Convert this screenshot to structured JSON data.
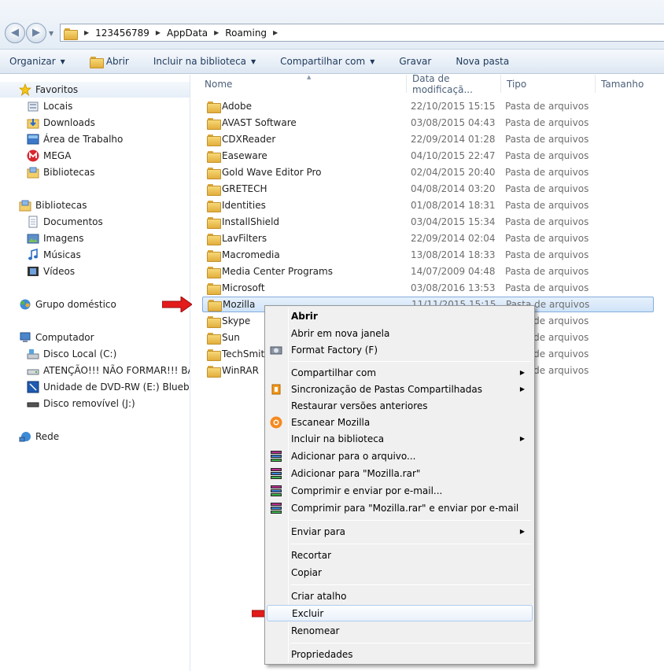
{
  "address": {
    "crumbs": [
      "123456789",
      "AppData",
      "Roaming"
    ]
  },
  "toolbar": {
    "organize": "Organizar",
    "open": "Abrir",
    "include_library": "Incluir na biblioteca",
    "share_with": "Compartilhar com",
    "burn": "Gravar",
    "new_folder": "Nova pasta"
  },
  "nav": {
    "favorites": "Favoritos",
    "places": "Locais",
    "downloads": "Downloads",
    "desktop": "Área de Trabalho",
    "mega": "MEGA",
    "libraries_fav": "Bibliotecas",
    "libraries": "Bibliotecas",
    "documents": "Documentos",
    "images": "Imagens",
    "music": "Músicas",
    "videos": "Vídeos",
    "homegroup": "Grupo doméstico",
    "computer": "Computador",
    "local_disk": "Disco Local (C:)",
    "warning_disk": "ATENÇÃO!!! NÃO FORMAR!!!  BACK",
    "dvd": "Unidade de DVD-RW (E:) Bluebirds",
    "removable": "Disco removível (J:)",
    "network": "Rede"
  },
  "columns": {
    "name": "Nome",
    "date": "Data de modificaçã...",
    "type": "Tipo",
    "size": "Tamanho"
  },
  "files": [
    {
      "name": "Adobe",
      "date": "22/10/2015 15:15",
      "type": "Pasta de arquivos"
    },
    {
      "name": "AVAST Software",
      "date": "03/08/2015 04:43",
      "type": "Pasta de arquivos"
    },
    {
      "name": "CDXReader",
      "date": "22/09/2014 01:28",
      "type": "Pasta de arquivos"
    },
    {
      "name": "Easeware",
      "date": "04/10/2015 22:47",
      "type": "Pasta de arquivos"
    },
    {
      "name": "Gold Wave Editor Pro",
      "date": "02/04/2015 20:40",
      "type": "Pasta de arquivos"
    },
    {
      "name": "GRETECH",
      "date": "04/08/2014 03:20",
      "type": "Pasta de arquivos"
    },
    {
      "name": "Identities",
      "date": "01/08/2014 18:31",
      "type": "Pasta de arquivos"
    },
    {
      "name": "InstallShield",
      "date": "03/04/2015 15:34",
      "type": "Pasta de arquivos"
    },
    {
      "name": "LavFilters",
      "date": "22/09/2014 02:04",
      "type": "Pasta de arquivos"
    },
    {
      "name": "Macromedia",
      "date": "13/08/2014 18:33",
      "type": "Pasta de arquivos"
    },
    {
      "name": "Media Center Programs",
      "date": "14/07/2009 04:48",
      "type": "Pasta de arquivos"
    },
    {
      "name": "Microsoft",
      "date": "03/08/2016 13:53",
      "type": "Pasta de arquivos"
    },
    {
      "name": "Mozilla",
      "date": "11/11/2015 15:15",
      "type": "Pasta de arquivos"
    },
    {
      "name": "Skype",
      "date": "",
      "type": "Pasta de arquivos"
    },
    {
      "name": "Sun",
      "date": "",
      "type": "Pasta de arquivos"
    },
    {
      "name": "TechSmith",
      "date": "",
      "type": "Pasta de arquivos"
    },
    {
      "name": "WinRAR",
      "date": "",
      "type": "Pasta de arquivos"
    }
  ],
  "menu": {
    "open": "Abrir",
    "open_new_window": "Abrir em nova janela",
    "format_factory": "Format Factory (F)",
    "share_with": "Compartilhar com",
    "sync_folders": "Sincronização de Pastas Compartilhadas",
    "restore_versions": "Restaurar versões anteriores",
    "scan": "Escanear Mozilla",
    "include_library": "Incluir na biblioteca",
    "add_archive": "Adicionar para o arquivo...",
    "add_rar": "Adicionar para \"Mozilla.rar\"",
    "compress_email": "Comprimir e enviar por e-mail...",
    "compress_rar_email": "Comprimir para \"Mozilla.rar\" e enviar por e-mail",
    "send_to": "Enviar para",
    "cut": "Recortar",
    "copy": "Copiar",
    "create_shortcut": "Criar atalho",
    "delete": "Excluir",
    "rename": "Renomear",
    "properties": "Propriedades"
  },
  "colors": {
    "accent": "#1e395b",
    "arrow": "#e31b1b",
    "selection": "#cfe3f8"
  }
}
